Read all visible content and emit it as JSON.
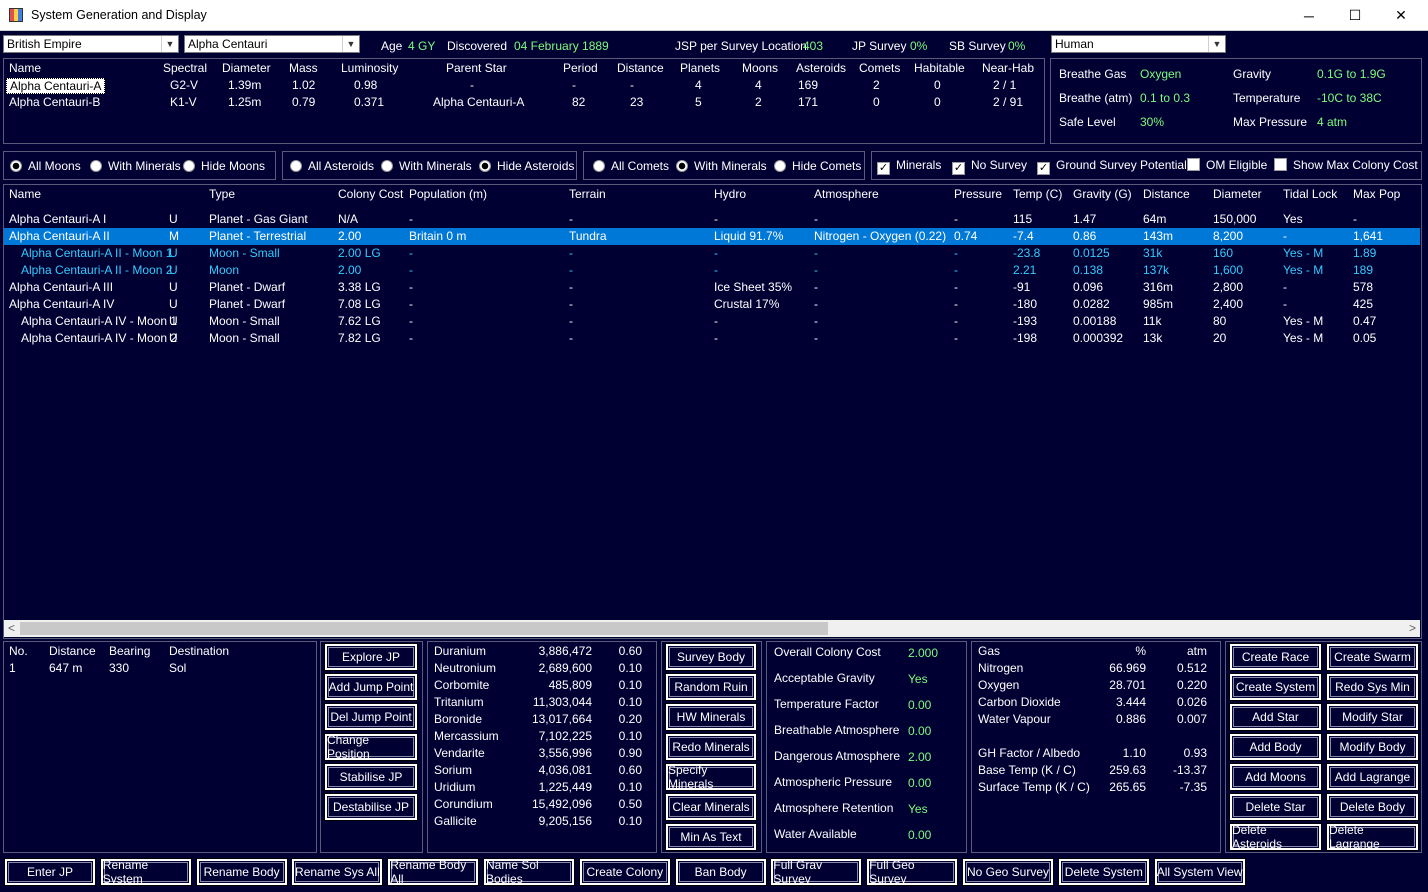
{
  "window": {
    "title": "System Generation and Display",
    "min": "─",
    "max": "☐",
    "close": "✕"
  },
  "top": {
    "empire": "British Empire",
    "system": "Alpha Centauri",
    "age_label": "Age",
    "age": "4 GY",
    "disc_label": "Discovered",
    "disc": "04 February 1889",
    "jsp_label": "JSP per Survey Location",
    "jsp": "403",
    "jp_label": "JP Survey",
    "jp": "0%",
    "sb_label": "SB Survey",
    "sb": "0%",
    "race": "Human"
  },
  "stars": {
    "headers": [
      "Name",
      "Spectral",
      "Diameter",
      "Mass",
      "Luminosity",
      "Parent Star",
      "Period",
      "Distance",
      "Planets",
      "Moons",
      "Asteroids",
      "Comets",
      "Habitable",
      "Near-Hab"
    ],
    "rows": [
      [
        "Alpha Centauri-A",
        "G2-V",
        "1.39m",
        "1.02",
        "0.98",
        "-",
        "-",
        "-",
        "4",
        "4",
        "169",
        "2",
        "0",
        "2 / 1"
      ],
      [
        "Alpha Centauri-B",
        "K1-V",
        "1.25m",
        "0.79",
        "0.371",
        "Alpha Centauri-A",
        "82",
        "23",
        "5",
        "2",
        "171",
        "0",
        "0",
        "2 / 91"
      ]
    ]
  },
  "env": {
    "breathe_gas_l": "Breathe Gas",
    "breathe_gas": "Oxygen",
    "gravity_l": "Gravity",
    "gravity": "0.1G  to  1.9G",
    "breathe_atm_l": "Breathe (atm)",
    "breathe_atm": "0.1  to  0.3",
    "temp_l": "Temperature",
    "temp": "-10C  to  38C",
    "safe_l": "Safe Level",
    "safe": "30%",
    "maxp_l": "Max Pressure",
    "maxp": "4 atm"
  },
  "filters": {
    "moons": [
      "All Moons",
      "With Minerals",
      "Hide Moons"
    ],
    "asteroids": [
      "All Asteroids",
      "With Minerals",
      "Hide Asteroids"
    ],
    "comets": [
      "All Comets",
      "With Minerals",
      "Hide Comets"
    ],
    "checks": [
      "Minerals",
      "No Survey",
      "Ground Survey Potential",
      "OM Eligible",
      "Show Max Colony Cost"
    ]
  },
  "bodies": {
    "headers": [
      "Name",
      "Type",
      "Colony Cost",
      "Population (m)",
      "Terrain",
      "Hydro",
      "Atmosphere",
      "Pressure",
      "Temp (C)",
      "Gravity (G)",
      "Distance",
      "Diameter",
      "Tidal Lock",
      "Max Pop"
    ],
    "rows": [
      {
        "name": "Alpha Centauri-A I",
        "u": "U",
        "type": "Planet - Gas Giant",
        "cc": "N/A",
        "pop": "-",
        "terrain": "-",
        "hydro": "-",
        "atmo": "-",
        "press": "-",
        "temp": "115",
        "grav": "1.47",
        "dist": "64m",
        "diam": "150,000",
        "tidal": "Yes",
        "maxpop": "-",
        "style": "normal",
        "indent": 0
      },
      {
        "name": "Alpha Centauri-A II",
        "u": "M",
        "type": "Planet - Terrestrial",
        "cc": "2.00",
        "pop": "Britain 0 m",
        "terrain": "Tundra",
        "hydro": "Liquid 91.7%",
        "atmo": "Nitrogen - Oxygen (0.22)",
        "press": "0.74",
        "temp": "-7.4",
        "grav": "0.86",
        "dist": "143m",
        "diam": "8,200",
        "tidal": "-",
        "maxpop": "1,641",
        "style": "selected",
        "indent": 0
      },
      {
        "name": "Alpha Centauri-A II - Moon 1",
        "u": "U",
        "type": "Moon - Small",
        "cc": "2.00 LG",
        "pop": "-",
        "terrain": "-",
        "hydro": "-",
        "atmo": "-",
        "press": "-",
        "temp": "-23.8",
        "grav": "0.0125",
        "dist": "31k",
        "diam": "160",
        "tidal": "Yes - M",
        "maxpop": "1.89",
        "style": "cyan",
        "indent": 1
      },
      {
        "name": "Alpha Centauri-A II - Moon 2",
        "u": "U",
        "type": "Moon",
        "cc": "2.00",
        "pop": "-",
        "terrain": "-",
        "hydro": "-",
        "atmo": "-",
        "press": "-",
        "temp": "2.21",
        "grav": "0.138",
        "dist": "137k",
        "diam": "1,600",
        "tidal": "Yes - M",
        "maxpop": "189",
        "style": "cyan",
        "indent": 1
      },
      {
        "name": "Alpha Centauri-A III",
        "u": "U",
        "type": "Planet - Dwarf",
        "cc": "3.38 LG",
        "pop": "-",
        "terrain": "-",
        "hydro": "Ice Sheet 35%",
        "atmo": "-",
        "press": "-",
        "temp": "-91",
        "grav": "0.096",
        "dist": "316m",
        "diam": "2,800",
        "tidal": "-",
        "maxpop": "578",
        "style": "normal",
        "indent": 0
      },
      {
        "name": "Alpha Centauri-A IV",
        "u": "U",
        "type": "Planet - Dwarf",
        "cc": "7.08 LG",
        "pop": "-",
        "terrain": "-",
        "hydro": "Crustal 17%",
        "atmo": "-",
        "press": "-",
        "temp": "-180",
        "grav": "0.0282",
        "dist": "985m",
        "diam": "2,400",
        "tidal": "-",
        "maxpop": "425",
        "style": "normal",
        "indent": 0
      },
      {
        "name": "Alpha Centauri-A IV - Moon 1",
        "u": "U",
        "type": "Moon - Small",
        "cc": "7.62 LG",
        "pop": "-",
        "terrain": "-",
        "hydro": "-",
        "atmo": "-",
        "press": "-",
        "temp": "-193",
        "grav": "0.00188",
        "dist": "11k",
        "diam": "80",
        "tidal": "Yes - M",
        "maxpop": "0.47",
        "style": "normal",
        "indent": 1
      },
      {
        "name": "Alpha Centauri-A IV - Moon 2",
        "u": "U",
        "type": "Moon - Small",
        "cc": "7.82 LG",
        "pop": "-",
        "terrain": "-",
        "hydro": "-",
        "atmo": "-",
        "press": "-",
        "temp": "-198",
        "grav": "0.000392",
        "dist": "13k",
        "diam": "20",
        "tidal": "Yes - M",
        "maxpop": "0.05",
        "style": "normal",
        "indent": 1
      }
    ]
  },
  "jumps": {
    "headers": [
      "No.",
      "Distance",
      "Bearing",
      "Destination"
    ],
    "row": [
      "1",
      "647 m",
      "330",
      "Sol"
    ]
  },
  "jp_buttons": [
    "Explore JP",
    "Add Jump Point",
    "Del Jump Point",
    "Change Position",
    "Stabilise JP",
    "Destabilise JP"
  ],
  "minerals": [
    [
      "Duranium",
      "3,886,472",
      "0.60"
    ],
    [
      "Neutronium",
      "2,689,600",
      "0.10"
    ],
    [
      "Corbomite",
      "485,809",
      "0.10"
    ],
    [
      "Tritanium",
      "11,303,044",
      "0.10"
    ],
    [
      "Boronide",
      "13,017,664",
      "0.20"
    ],
    [
      "Mercassium",
      "7,102,225",
      "0.10"
    ],
    [
      "Vendarite",
      "3,556,996",
      "0.90"
    ],
    [
      "Sorium",
      "4,036,081",
      "0.60"
    ],
    [
      "Uridium",
      "1,225,449",
      "0.10"
    ],
    [
      "Corundium",
      "15,492,096",
      "0.50"
    ],
    [
      "Gallicite",
      "9,205,156",
      "0.10"
    ]
  ],
  "survey_buttons": [
    "Survey Body",
    "Random Ruin",
    "HW Minerals",
    "Redo Minerals",
    "Specify Minerals",
    "Clear Minerals",
    "Min As Text"
  ],
  "colony": [
    [
      "Overall Colony Cost",
      "2.000"
    ],
    [
      "Acceptable Gravity",
      "Yes"
    ],
    [
      "Temperature Factor",
      "0.00"
    ],
    [
      "Breathable Atmosphere",
      "0.00"
    ],
    [
      "Dangerous Atmosphere",
      "2.00"
    ],
    [
      "Atmospheric Pressure",
      "0.00"
    ],
    [
      "Atmosphere Retention",
      "Yes"
    ],
    [
      "Water Available",
      "0.00"
    ]
  ],
  "gas": {
    "headers": [
      "Gas",
      "%",
      "atm"
    ],
    "rows": [
      [
        "Nitrogen",
        "66.969",
        "0.512"
      ],
      [
        "Oxygen",
        "28.701",
        "0.220"
      ],
      [
        "Carbon Dioxide",
        "3.444",
        "0.026"
      ],
      [
        "Water Vapour",
        "0.886",
        "0.007"
      ]
    ],
    "extra": [
      [
        "GH Factor / Albedo",
        "1.10",
        "0.93"
      ],
      [
        "Base Temp (K / C)",
        "259.63",
        "-13.37"
      ],
      [
        "Surface Temp (K / C)",
        "265.65",
        "-7.35"
      ]
    ]
  },
  "right_buttons": [
    [
      "Create Race",
      "Create Swarm"
    ],
    [
      "Create System",
      "Redo Sys Min"
    ],
    [
      "Add Star",
      "Modify Star"
    ],
    [
      "Add Body",
      "Modify Body"
    ],
    [
      "Add Moons",
      "Add Lagrange"
    ],
    [
      "Delete Star",
      "Delete Body"
    ],
    [
      "Delete Asteroids",
      "Delete Lagrange"
    ]
  ],
  "bottom_buttons": [
    "Enter JP",
    "Rename System",
    "Rename Body",
    "Rename Sys All",
    "Rename Body All",
    "Name Sol Bodies",
    "Create Colony",
    "Ban Body",
    "Full Grav Survey",
    "Full Geo Survey",
    "No Geo Survey",
    "Delete System",
    "All System View"
  ],
  "scroll": {
    "left": "<",
    "right": ">"
  },
  "colors": {
    "bg": "#000033",
    "accent": "#0078d7",
    "value": "#7cfc7c",
    "moon": "#33ccff"
  }
}
